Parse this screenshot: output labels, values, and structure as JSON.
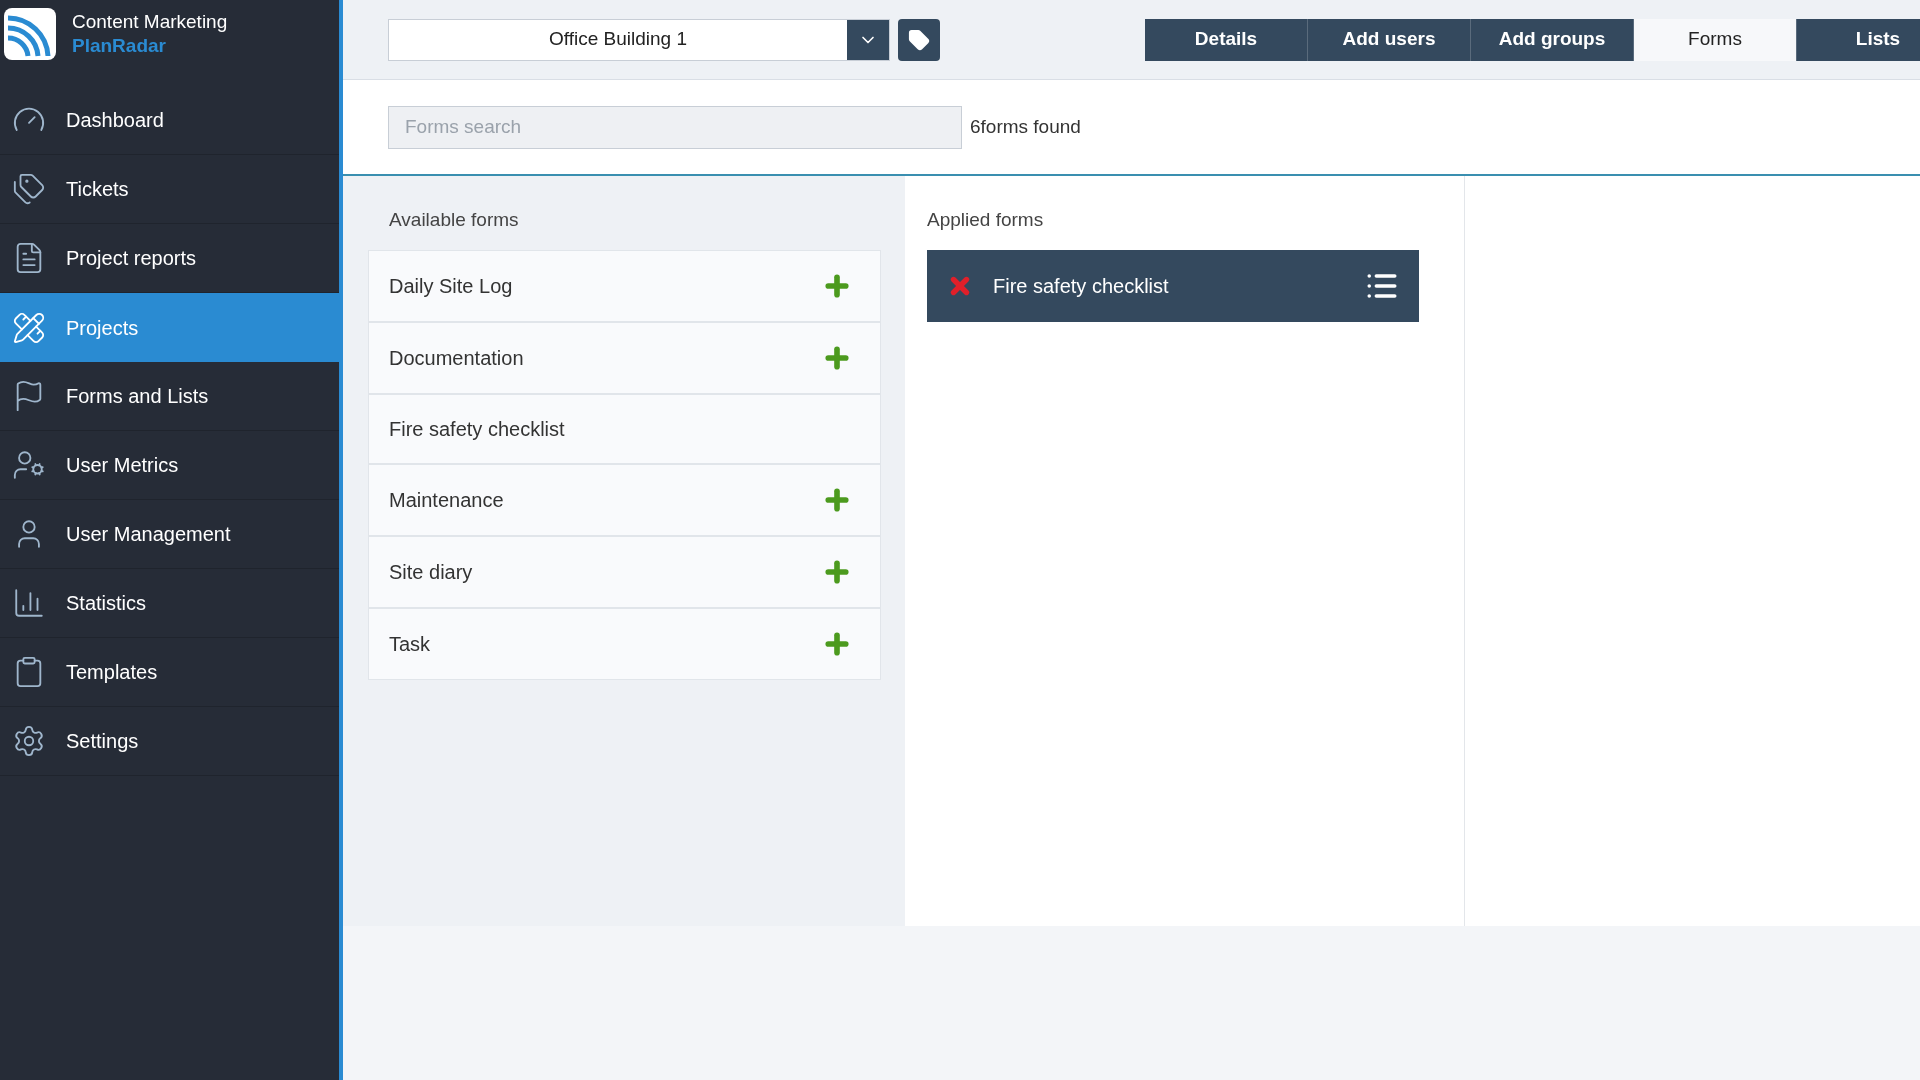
{
  "brand": {
    "title": "Content Marketing",
    "subtitle": "PlanRadar"
  },
  "sidebar": {
    "items": [
      {
        "label": "Dashboard",
        "kind": "dashboard",
        "selected": false
      },
      {
        "label": "Tickets",
        "kind": "tickets",
        "selected": false
      },
      {
        "label": "Project reports",
        "kind": "reports",
        "selected": false
      },
      {
        "label": "Projects",
        "kind": "projects",
        "selected": true
      },
      {
        "label": "Forms and Lists",
        "kind": "forms",
        "selected": false
      },
      {
        "label": "User Metrics",
        "kind": "metrics",
        "selected": false
      },
      {
        "label": "User Management",
        "kind": "users",
        "selected": false
      },
      {
        "label": "Statistics",
        "kind": "statistics",
        "selected": false
      },
      {
        "label": "Templates",
        "kind": "templates",
        "selected": false
      },
      {
        "label": "Settings",
        "kind": "settings",
        "selected": false
      }
    ]
  },
  "project_select": {
    "value": "Office Building 1"
  },
  "tabs": [
    {
      "label": "Details",
      "selected": false
    },
    {
      "label": "Add users",
      "selected": false
    },
    {
      "label": "Add groups",
      "selected": false
    },
    {
      "label": "Forms",
      "selected": true
    },
    {
      "label": "Lists",
      "selected": false
    }
  ],
  "search": {
    "placeholder": "Forms search",
    "result": "6forms found"
  },
  "available_forms": {
    "title": "Available forms",
    "items": [
      {
        "label": "Daily Site Log",
        "applied": false
      },
      {
        "label": "Documentation",
        "applied": false
      },
      {
        "label": "Fire safety checklist",
        "applied": true
      },
      {
        "label": "Maintenance",
        "applied": false
      },
      {
        "label": "Site diary",
        "applied": false
      },
      {
        "label": "Task",
        "applied": false
      }
    ]
  },
  "applied_forms": {
    "title": "Applied forms",
    "items": [
      {
        "label": "Fire safety checklist"
      }
    ]
  }
}
